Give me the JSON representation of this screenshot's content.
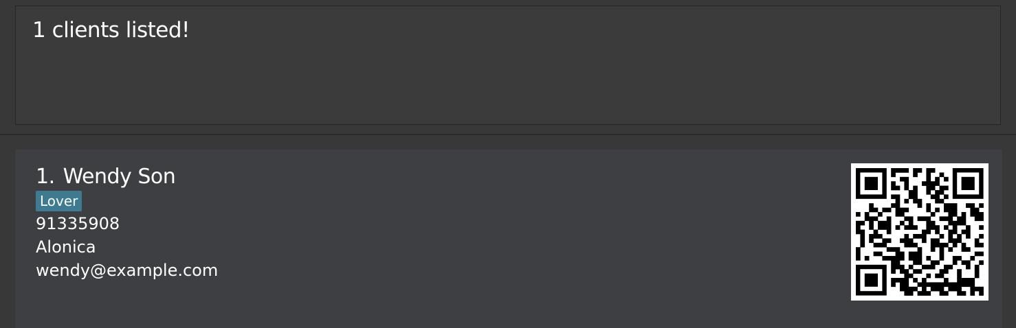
{
  "result_display": {
    "message": "1 clients listed!"
  },
  "client_list": {
    "clients": [
      {
        "index": "1.",
        "name": "Wendy Son",
        "tags": [
          "Lover"
        ],
        "phone": "91335908",
        "address": "Alonica",
        "email": "wendy@example.com",
        "qr_icon": "qr-code-icon"
      }
    ]
  },
  "colors": {
    "background": "#383838",
    "card": "#3e3f42",
    "tag": "#3e7b91",
    "text": "#ffffff"
  }
}
